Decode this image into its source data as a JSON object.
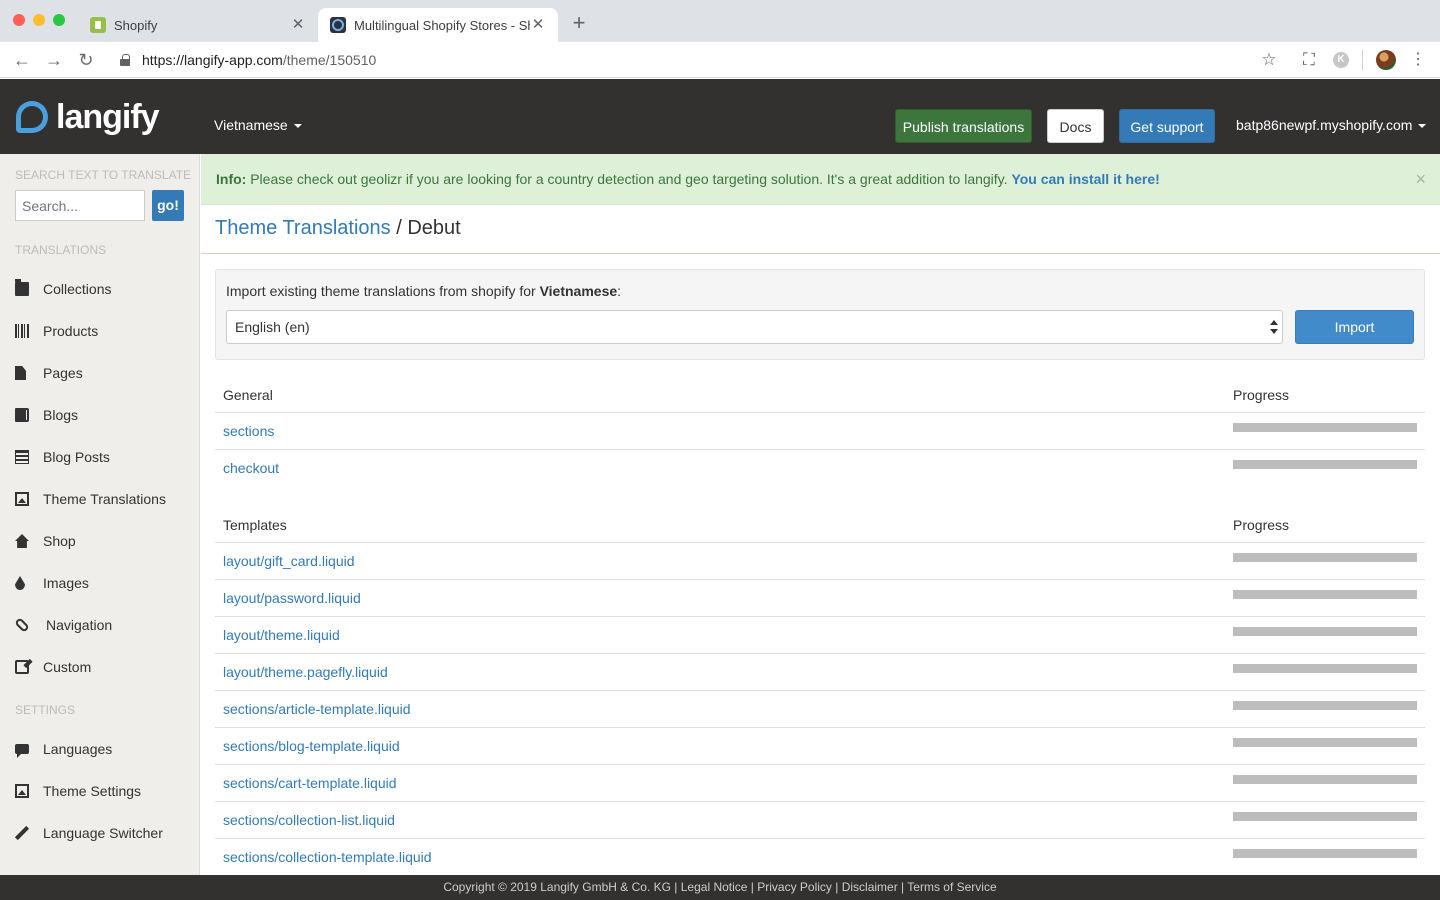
{
  "browser": {
    "tabs": [
      {
        "title": "Shopify",
        "active": false
      },
      {
        "title": "Multilingual Shopify Stores - Sh",
        "active": true
      }
    ],
    "url_host": "https://langify-app.com",
    "url_path": "/theme/150510",
    "profile_initial": "K"
  },
  "header": {
    "logo_text": "langify",
    "language": "Vietnamese",
    "publish_label": "Publish translations",
    "docs_label": "Docs",
    "support_label": "Get support",
    "account": "batp86newpf.myshopify.com"
  },
  "sidebar": {
    "search_heading": "SEARCH TEXT TO TRANSLATE",
    "search_placeholder": "Search...",
    "search_button": "go!",
    "translations_heading": "TRANSLATIONS",
    "translation_items": [
      {
        "label": "Collections",
        "icon": "folder-icon"
      },
      {
        "label": "Products",
        "icon": "barcode-icon"
      },
      {
        "label": "Pages",
        "icon": "file-icon"
      },
      {
        "label": "Blogs",
        "icon": "book-icon"
      },
      {
        "label": "Blog Posts",
        "icon": "list-icon"
      },
      {
        "label": "Theme Translations",
        "icon": "picture-icon"
      },
      {
        "label": "Shop",
        "icon": "home-icon"
      },
      {
        "label": "Images",
        "icon": "drop-icon"
      },
      {
        "label": "Navigation",
        "icon": "link-icon"
      },
      {
        "label": "Custom",
        "icon": "edit-icon"
      }
    ],
    "settings_heading": "SETTINGS",
    "settings_items": [
      {
        "label": "Languages",
        "icon": "comment-icon"
      },
      {
        "label": "Theme Settings",
        "icon": "picture-icon"
      },
      {
        "label": "Language Switcher",
        "icon": "pencil-icon"
      }
    ]
  },
  "alert": {
    "prefix": "Info:",
    "message": " Please check out geolizr if you are looking for a country detection and geo targeting solution. It's a great addition to langify. ",
    "link": "You can install it here!",
    "close": "×"
  },
  "page": {
    "breadcrumb_link": "Theme Translations",
    "separator": " / ",
    "current": "Debut"
  },
  "import": {
    "label_prefix": "Import existing theme translations from shopify for ",
    "language": "Vietnamese",
    "label_suffix": ":",
    "selected_option": "English (en)",
    "button": "Import"
  },
  "general_table": {
    "heading": "General",
    "progress_heading": "Progress",
    "rows": [
      {
        "name": "sections",
        "progress": 0
      },
      {
        "name": "checkout",
        "progress": 0
      }
    ]
  },
  "templates_table": {
    "heading": "Templates",
    "progress_heading": "Progress",
    "rows": [
      {
        "name": "layout/gift_card.liquid",
        "progress": 0
      },
      {
        "name": "layout/password.liquid",
        "progress": 0
      },
      {
        "name": "layout/theme.liquid",
        "progress": 0
      },
      {
        "name": "layout/theme.pagefly.liquid",
        "progress": 0
      },
      {
        "name": "sections/article-template.liquid",
        "progress": 0
      },
      {
        "name": "sections/blog-template.liquid",
        "progress": 0
      },
      {
        "name": "sections/cart-template.liquid",
        "progress": 0
      },
      {
        "name": "sections/collection-list.liquid",
        "progress": 0
      },
      {
        "name": "sections/collection-template.liquid",
        "progress": 0
      }
    ]
  },
  "footer": {
    "text": "Copyright © 2019 Langify GmbH & Co. KG | Legal Notice | Privacy Policy | Disclaimer | Terms of Service"
  }
}
